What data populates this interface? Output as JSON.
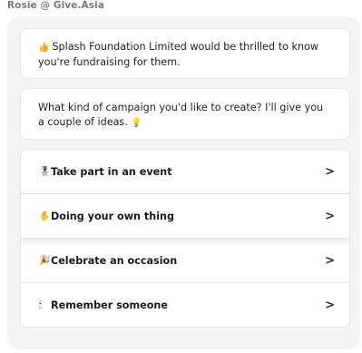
{
  "sender": "Rosie @ Give.Asia",
  "messages": [
    {
      "emoji": "👍",
      "text": "Splash Foundation Limited would be thrilled to know you're fundraising for them."
    },
    {
      "emoji": "💡",
      "text": "What kind of campaign you'd like to create? I'll give you a couple of ideas."
    }
  ],
  "options": [
    {
      "emoji": "🎖",
      "label": "Take part in an event",
      "chevron": ">"
    },
    {
      "emoji": "✋",
      "label": "Doing your own thing",
      "chevron": ">"
    },
    {
      "emoji": "🎉",
      "label": "Celebrate an occasion",
      "chevron": ">"
    },
    {
      "emoji": "🕯",
      "label": "Remember someone",
      "chevron": ">"
    }
  ],
  "colors": {
    "panel_bg": "#f3f3f3",
    "card_bg": "#ffffff",
    "sender_text": "#7a7a7a"
  }
}
